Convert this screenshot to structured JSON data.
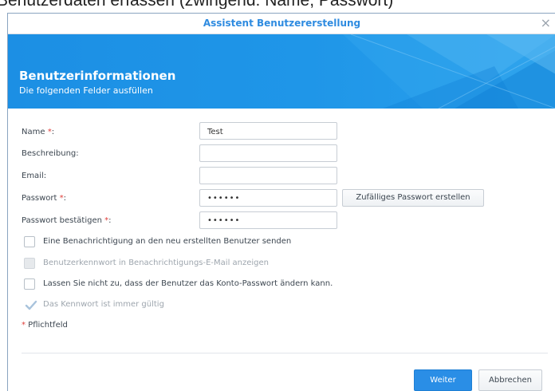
{
  "caption": "Benutzerdaten erfassen (zwingend: Name, Passwort)",
  "dialog": {
    "title": "Assistent Benutzererstellung",
    "close_glyph": "×"
  },
  "banner": {
    "heading": "Benutzerinformationen",
    "subheading": "Die folgenden Felder ausfüllen"
  },
  "form": {
    "name": {
      "label": "Name",
      "required_mark": "*",
      "suffix": ":",
      "value": "Test"
    },
    "description": {
      "label": "Beschreibung:",
      "value": ""
    },
    "email": {
      "label": "Email:",
      "value": ""
    },
    "password": {
      "label": "Passwort",
      "required_mark": "*",
      "suffix": ":",
      "value": "••••••"
    },
    "password_confirm": {
      "label": "Passwort bestätigen",
      "required_mark": "*",
      "suffix": ":",
      "value": "••••••"
    },
    "random_password_button": "Zufälliges Passwort erstellen"
  },
  "options": [
    {
      "label": "Eine Benachrichtigung an den neu erstellten Benutzer senden",
      "checked": false,
      "disabled": false
    },
    {
      "label": "Benutzerkennwort in Benachrichtigungs-E-Mail anzeigen",
      "checked": false,
      "disabled": true
    },
    {
      "label": "Lassen Sie nicht zu, dass der Benutzer das Konto-Passwort ändern kann.",
      "checked": false,
      "disabled": false
    },
    {
      "label": "Das Kennwort ist immer gültig",
      "checked": true,
      "disabled": true
    }
  ],
  "required_note": {
    "mark": "*",
    "text": " Pflichtfeld"
  },
  "footer": {
    "next_label": "Weiter",
    "cancel_label": "Abbrechen"
  },
  "colors": {
    "accent": "#2a8ee6",
    "banner": "#1f96e8",
    "required": "#e0403c"
  },
  "icons": {
    "close": "close-icon",
    "checkmark": "checkmark-icon"
  }
}
